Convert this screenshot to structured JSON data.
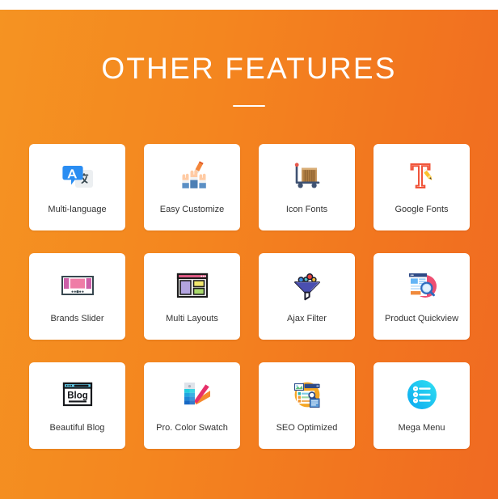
{
  "section": {
    "title": "OTHER FEATURES",
    "divider": true,
    "background": {
      "gradient_from": "#f59322",
      "gradient_to": "#f06a22"
    },
    "card_background": "#ffffff",
    "label_color": "#333333"
  },
  "features": [
    {
      "label": "Multi-language",
      "icon": "translate-icon"
    },
    {
      "label": "Easy Customize",
      "icon": "hands-pencil-icon"
    },
    {
      "label": "Icon Fonts",
      "icon": "hand-truck-box-icon"
    },
    {
      "label": "Google Fonts",
      "icon": "letter-t-pen-icon"
    },
    {
      "label": "Brands Slider",
      "icon": "carousel-slider-icon"
    },
    {
      "label": "Multi Layouts",
      "icon": "browser-layout-icon"
    },
    {
      "label": "Ajax Filter",
      "icon": "funnel-balls-icon"
    },
    {
      "label": "Product Quickview",
      "icon": "page-magnifier-icon"
    },
    {
      "label": "Beautiful Blog",
      "icon": "blog-window-icon"
    },
    {
      "label": "Pro. Color Swatch",
      "icon": "color-fan-icon"
    },
    {
      "label": "SEO Optimized",
      "icon": "seo-documents-icon"
    },
    {
      "label": "Mega Menu",
      "icon": "list-circle-icon"
    }
  ]
}
